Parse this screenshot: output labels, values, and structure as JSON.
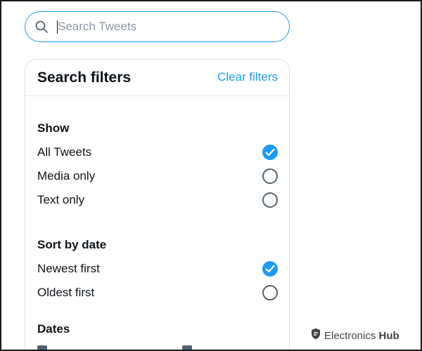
{
  "search": {
    "placeholder": "Search Tweets",
    "value": ""
  },
  "filters": {
    "title": "Search filters",
    "clear_label": "Clear filters",
    "sections": [
      {
        "title": "Show",
        "options": [
          {
            "label": "All Tweets",
            "checked": true
          },
          {
            "label": "Media only",
            "checked": false
          },
          {
            "label": "Text only",
            "checked": false
          }
        ]
      },
      {
        "title": "Sort by date",
        "options": [
          {
            "label": "Newest first",
            "checked": true
          },
          {
            "label": "Oldest first",
            "checked": false
          }
        ]
      },
      {
        "title": "Dates"
      }
    ]
  },
  "watermark": {
    "brand": "Electronics",
    "brand_bold": "Hub"
  },
  "colors": {
    "accent": "#1d9bf0",
    "text": "#0f1419",
    "radio_border": "#536471"
  }
}
